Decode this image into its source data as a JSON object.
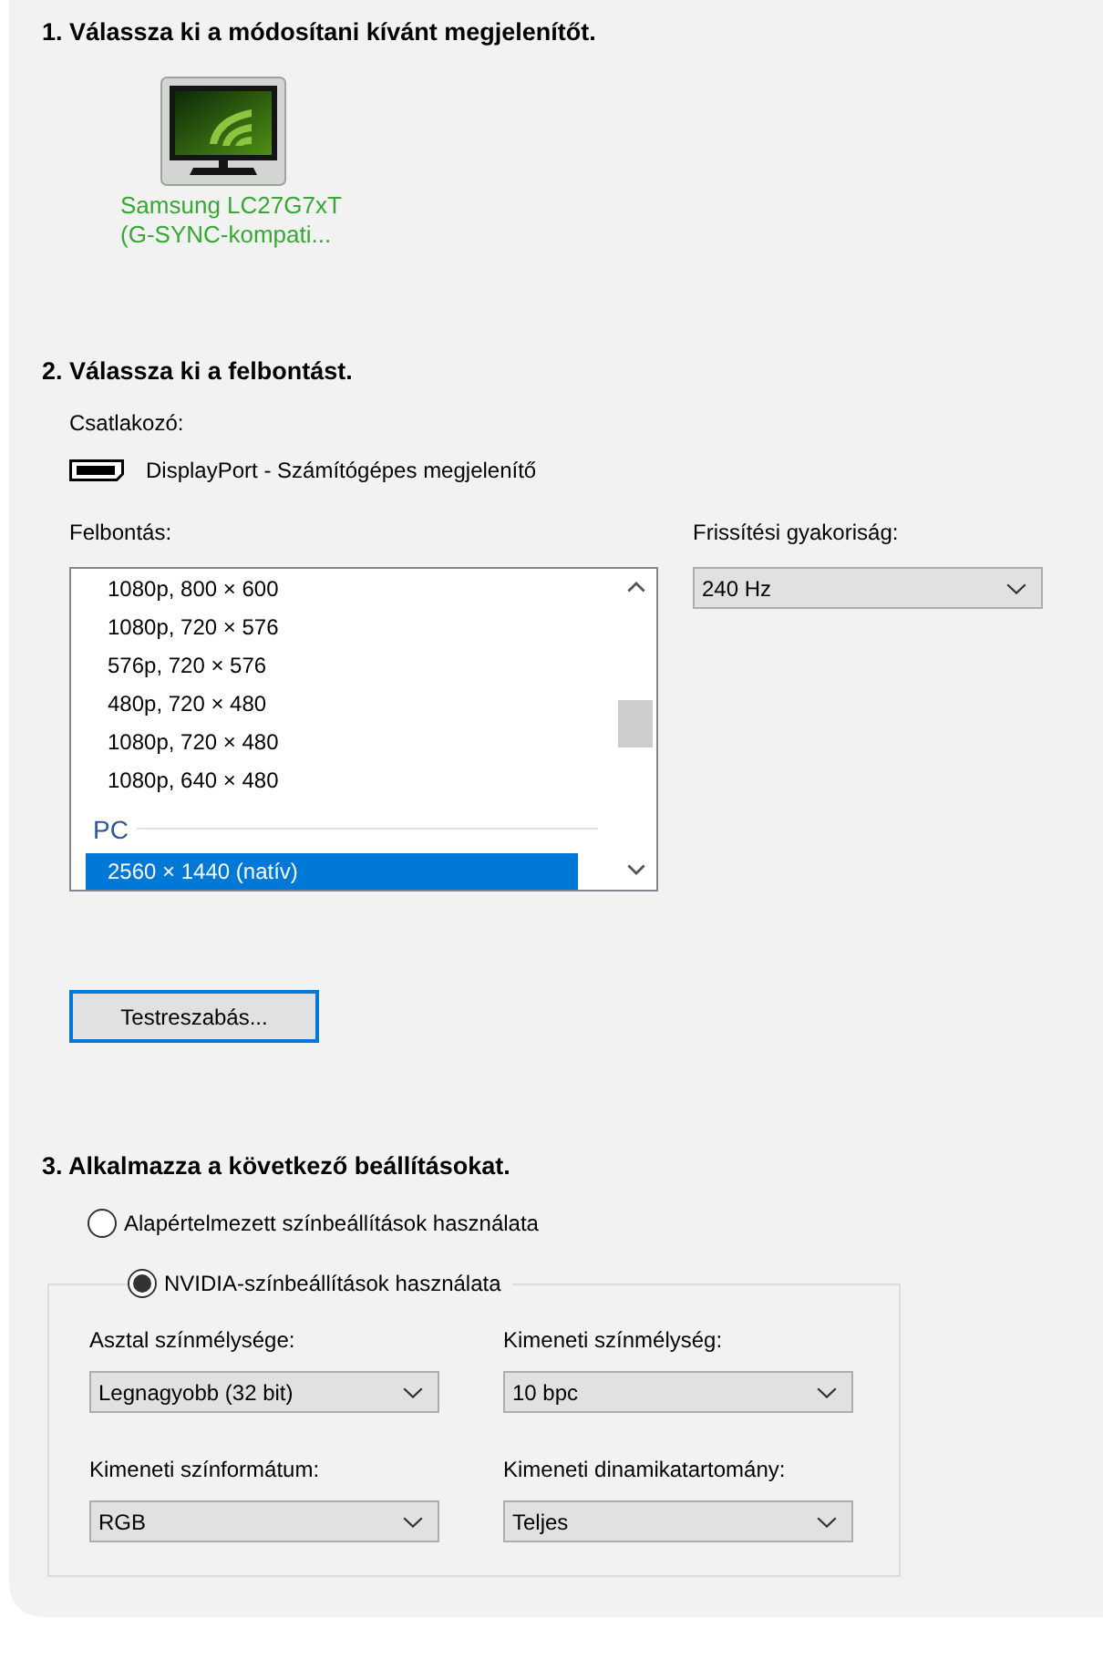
{
  "display_section": {
    "heading": "1. Válassza ki a módosítani kívánt megjelenítőt.",
    "displays": [
      {
        "name": "Samsung LC27G7xT (G-SYNC-kompati...",
        "selected": true
      }
    ]
  },
  "resolution_section": {
    "heading": "2. Válassza ki a felbontást.",
    "connector_label": "Csatlakozó:",
    "connector": "DisplayPort - Számítógépes megjelenítő",
    "resolution_label": "Felbontás:",
    "resolutions": [
      {
        "kind": "mode",
        "label": "1080p, 800 × 600",
        "selected": false
      },
      {
        "kind": "mode",
        "label": "1080p, 720 × 576",
        "selected": false
      },
      {
        "kind": "mode",
        "label": "576p, 720 × 576",
        "selected": false
      },
      {
        "kind": "mode",
        "label": "480p, 720 × 480",
        "selected": false
      },
      {
        "kind": "mode",
        "label": "1080p, 720 × 480",
        "selected": false
      },
      {
        "kind": "mode",
        "label": "1080p, 640 × 480",
        "selected": false
      },
      {
        "kind": "group",
        "label": "PC"
      },
      {
        "kind": "mode",
        "label": "2560 × 1440 (natív)",
        "selected": true
      }
    ],
    "refresh_label": "Frissítési gyakoriság:",
    "refresh_rate": "240 Hz",
    "customize_button": {
      "label": "Testreszabás...",
      "focused": true
    }
  },
  "color_section": {
    "heading": "3. Alkalmazza a következő beállításokat.",
    "options": [
      {
        "label": "Alapértelmezett színbeállítások használata",
        "selected": false
      },
      {
        "label": "NVIDIA-színbeállítások használata",
        "selected": true
      }
    ],
    "fields": [
      {
        "label": "Asztal színmélysége:",
        "value": "Legnagyobb (32 bit)"
      },
      {
        "label": "Kimeneti színmélység:",
        "value": "10 bpc"
      },
      {
        "label": "Kimeneti színformátum:",
        "value": "RGB"
      },
      {
        "label": "Kimeneti dinamikatartomány:",
        "value": "Teljes"
      }
    ]
  }
}
